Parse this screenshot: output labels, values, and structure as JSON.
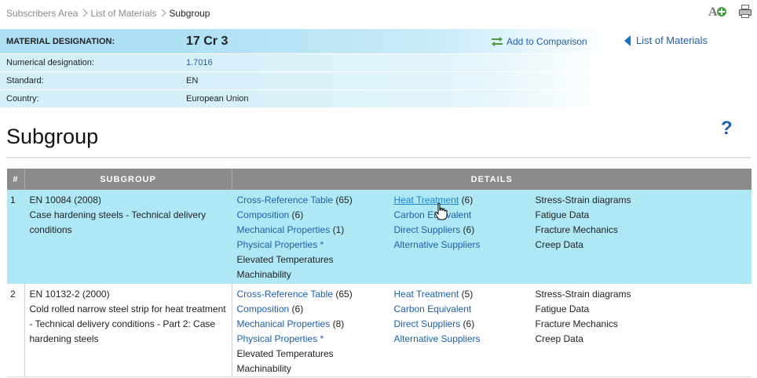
{
  "breadcrumb": {
    "items": [
      "Subscribers Area",
      "List of Materials",
      "Subgroup"
    ]
  },
  "toolbar": {
    "font_icon_letter": "A",
    "icons": [
      "font-size-add-icon",
      "print-icon"
    ]
  },
  "material": {
    "designation_label": "MATERIAL DESIGNATION:",
    "designation_value": "17 Cr 3",
    "rows": [
      {
        "label": "Numerical designation:",
        "value": "1.7016"
      },
      {
        "label": "Standard:",
        "value": "EN"
      },
      {
        "label": "Country:",
        "value": "European Union"
      }
    ],
    "add_comparison": "Add to Comparison",
    "list_materials": "List of Materials"
  },
  "page": {
    "title": "Subgroup",
    "help": "?"
  },
  "table": {
    "headers": {
      "num": "#",
      "subgroup": "SUBGROUP",
      "details": "DETAILS"
    },
    "rows": [
      {
        "num": "1",
        "standard": "EN 10084 (2008)",
        "description": "Case hardening steels - Technical delivery conditions",
        "col1": [
          {
            "text": "Cross-Reference Table",
            "count": "(65)",
            "link": true
          },
          {
            "text": "Composition",
            "count": "(6)",
            "link": true
          },
          {
            "text": "Mechanical Properties",
            "count": "(1)",
            "link": true
          },
          {
            "text": "Physical Properties *",
            "count": "",
            "link": true
          },
          {
            "text": "Elevated Temperatures",
            "count": "",
            "link": false
          },
          {
            "text": "Machinability",
            "count": "",
            "link": false
          }
        ],
        "col2": [
          {
            "text": "Heat Treatment",
            "count": "(6)",
            "link": true
          },
          {
            "text": "Carbon Equivalent",
            "count": "",
            "link": true
          },
          {
            "text": "Direct Suppliers",
            "count": "(6)",
            "link": true
          },
          {
            "text": "Alternative Suppliers",
            "count": "",
            "link": true
          }
        ],
        "col3": [
          {
            "text": "Stress-Strain diagrams",
            "link": false
          },
          {
            "text": "Fatigue Data",
            "link": false
          },
          {
            "text": "Fracture Mechanics",
            "link": false
          },
          {
            "text": "Creep Data",
            "link": false
          }
        ]
      },
      {
        "num": "2",
        "standard": "EN 10132-2 (2000)",
        "description": "Cold rolled narrow steel strip for heat treatment - Technical delivery conditions - Part 2: Case hardening steels",
        "col1": [
          {
            "text": "Cross-Reference Table",
            "count": "(65)",
            "link": true
          },
          {
            "text": "Composition",
            "count": "(6)",
            "link": true
          },
          {
            "text": "Mechanical Properties",
            "count": "(8)",
            "link": true
          },
          {
            "text": "Physical Properties *",
            "count": "",
            "link": true
          },
          {
            "text": "Elevated Temperatures",
            "count": "",
            "link": false
          },
          {
            "text": "Machinability",
            "count": "",
            "link": false
          }
        ],
        "col2": [
          {
            "text": "Heat Treatment",
            "count": "(5)",
            "link": true
          },
          {
            "text": "Carbon Equivalent",
            "count": "",
            "link": true
          },
          {
            "text": "Direct Suppliers",
            "count": "(6)",
            "link": true
          },
          {
            "text": "Alternative Suppliers",
            "count": "",
            "link": true
          }
        ],
        "col3": [
          {
            "text": "Stress-Strain diagrams",
            "link": false
          },
          {
            "text": "Fatigue Data",
            "link": false
          },
          {
            "text": "Fracture Mechanics",
            "link": false
          },
          {
            "text": "Creep Data",
            "link": false
          }
        ]
      }
    ]
  },
  "colors": {
    "link": "#1f5fa8",
    "highlight_row": "#aee8f5",
    "header_band": "#aee0f4",
    "table_header": "#8b8b8b"
  }
}
